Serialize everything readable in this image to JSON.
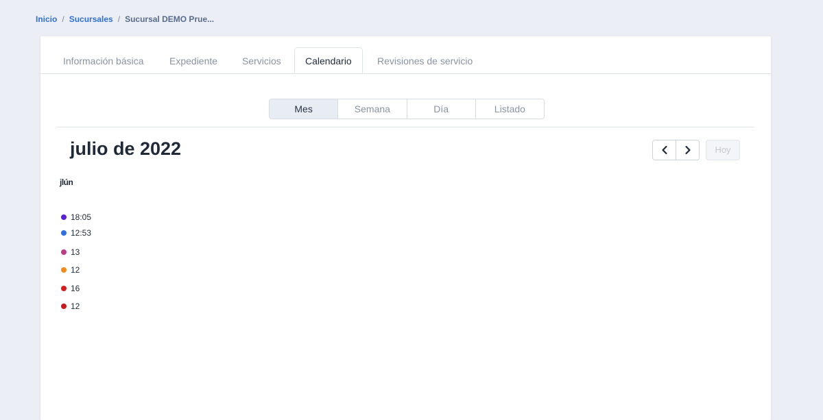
{
  "breadcrumb": {
    "items": [
      "Inicio",
      "Sucursales"
    ],
    "current": "Sucursal DEMO Prue...",
    "separator": "/"
  },
  "tabs": [
    {
      "label": "Información básica"
    },
    {
      "label": "Expediente"
    },
    {
      "label": "Servicios"
    },
    {
      "label": "Calendario",
      "active": true
    },
    {
      "label": "Revisiones de servicio"
    }
  ],
  "view_switch": [
    {
      "label": "Mes",
      "active": true
    },
    {
      "label": "Semana"
    },
    {
      "label": "Día"
    },
    {
      "label": "Listado"
    }
  ],
  "calendar": {
    "title": "julio de 2022",
    "today_label": "Hoy",
    "prev_icon": "chevron-left-icon",
    "next_icon": "chevron-right-icon",
    "day_header": "jlún",
    "events": [
      {
        "time": "18:05",
        "color": "#5b21d6"
      },
      {
        "time": "12:53",
        "color": "#2f6fe0"
      },
      {
        "time": "13",
        "color": "#c0388a"
      },
      {
        "time": "12",
        "color": "#f08a1c"
      },
      {
        "time": "16",
        "color": "#d61e1e"
      },
      {
        "time": "12",
        "color": "#c81c1c"
      }
    ]
  }
}
